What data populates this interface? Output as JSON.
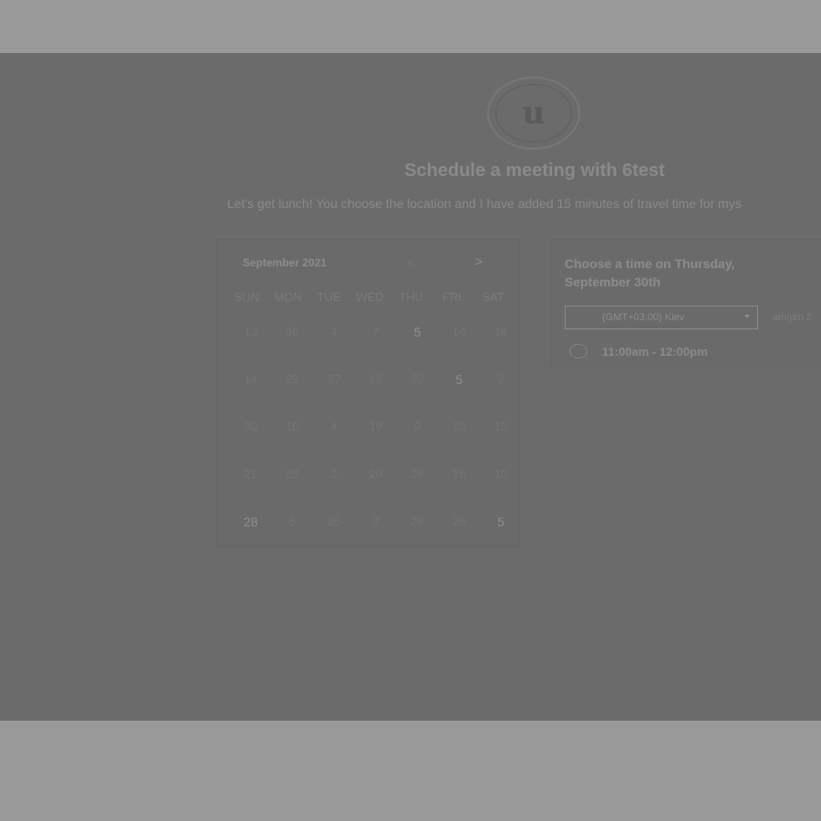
{
  "header": {
    "avatar_letter": "u",
    "title": "Schedule a meeting with 6test",
    "subtitle": "Let's get lunch! You choose the location and I have added 15 minutes of travel time for mys"
  },
  "calendar": {
    "month_label": "September 2021",
    "prev_icon": "‹",
    "next_icon": ">",
    "weekdays": [
      "SUN",
      "MON",
      "TUE",
      "WED",
      "THU",
      "FRI",
      "SAT"
    ],
    "days": [
      {
        "label": "13",
        "available": false
      },
      {
        "label": "30",
        "available": false
      },
      {
        "label": "4",
        "available": false
      },
      {
        "label": "7",
        "available": false
      },
      {
        "label": "5",
        "available": true
      },
      {
        "label": "14",
        "available": false
      },
      {
        "label": "16",
        "available": false
      },
      {
        "label": "14",
        "available": false
      },
      {
        "label": "22",
        "available": false
      },
      {
        "label": "27",
        "available": false
      },
      {
        "label": "18",
        "available": false
      },
      {
        "label": "20",
        "available": false
      },
      {
        "label": "5",
        "available": true
      },
      {
        "label": "2",
        "available": false
      },
      {
        "label": "30",
        "available": false
      },
      {
        "label": "10",
        "available": false
      },
      {
        "label": "4",
        "available": false
      },
      {
        "label": "19",
        "available": false
      },
      {
        "label": "9",
        "available": false
      },
      {
        "label": "20",
        "available": false
      },
      {
        "label": "15",
        "available": false
      },
      {
        "label": "21",
        "available": false
      },
      {
        "label": "28",
        "available": false
      },
      {
        "label": "2",
        "available": false
      },
      {
        "label": "20",
        "available": false
      },
      {
        "label": "26",
        "available": false
      },
      {
        "label": "16",
        "available": false
      },
      {
        "label": "10",
        "available": false
      },
      {
        "label": "28",
        "available": true
      },
      {
        "label": "5",
        "available": false
      },
      {
        "label": "25",
        "available": false
      },
      {
        "label": "3",
        "available": false
      },
      {
        "label": "26",
        "available": false
      },
      {
        "label": "29",
        "available": false
      },
      {
        "label": "5",
        "available": true
      }
    ]
  },
  "times": {
    "heading": "Choose a time on Thursday, September 30th",
    "timezone": "(GMT+03:00) Kiev",
    "format_label": "am/pm  2",
    "slots": [
      "11:00am - 12:00pm"
    ]
  },
  "icons": {
    "avatar": "avatar-icon",
    "prev": "chevron-left-icon",
    "next": "chevron-right-icon",
    "dropdown": "caret-down-icon",
    "radio": "radio-icon"
  }
}
